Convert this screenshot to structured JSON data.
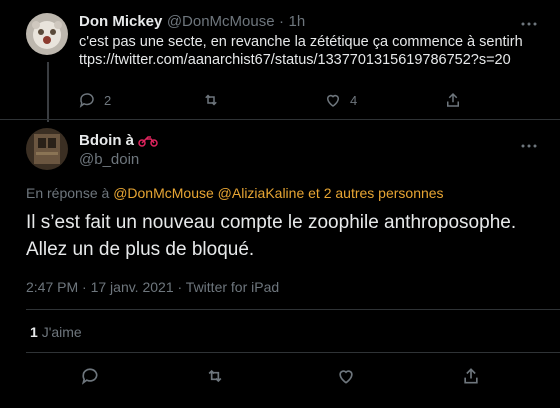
{
  "tweet1": {
    "display_name": "Don Mickey",
    "handle": "@DonMcMouse",
    "dot": "·",
    "time": "1h",
    "text": "c'est pas une secte, en revanche la zététique ça commence à sentirhttps://twitter.com/aanarchist67/status/1337701315619786752?s=20",
    "reply_count": "2",
    "retweet_count": "",
    "like_count": "4"
  },
  "tweet2": {
    "display_name": "Bdoin à",
    "handle": "@b_doin",
    "reply_prefix": "En réponse à",
    "mentions": [
      "@DonMcMouse",
      "@AliziaKaline"
    ],
    "reply_suffix": "et 2 autres personnes",
    "text": "Il s’est fait un nouveau compte le zoophile anthroposophe. Allez un de plus de bloqué.",
    "timestamp": "2:47 PM · 17 janv. 2021 · Twitter for iPad",
    "like_count": "1",
    "like_label": "J'aime"
  },
  "icons": {
    "more": "more-dots-icon",
    "reply": "reply-icon",
    "retweet": "retweet-icon",
    "like": "heart-icon",
    "share": "share-icon",
    "emoji": "motorcycle-icon"
  },
  "colors": {
    "background": "#000000",
    "text": "#e7e9ea",
    "muted": "#6e767d",
    "accent": "#e7a533",
    "divider": "#2f3336"
  }
}
